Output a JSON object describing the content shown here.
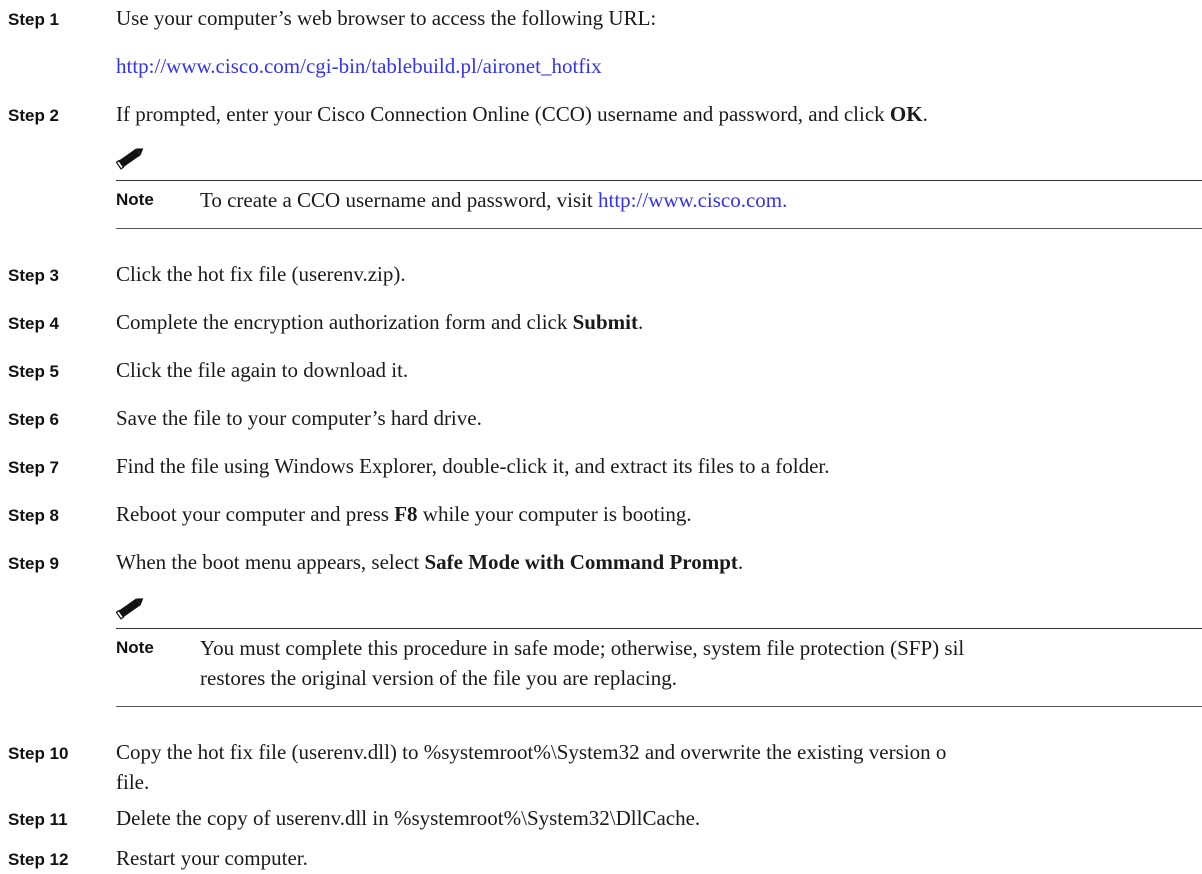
{
  "steps": [
    {
      "label": "Step 1",
      "text": "Use your computer’s web browser to access the following URL:",
      "link": "http://www.cisco.com/cgi-bin/tablebuild.pl/aironet_hotfix"
    },
    {
      "label": "Step 2",
      "text_before": "If prompted, enter your Cisco Connection Online (CCO) username and password, and click ",
      "bold": "OK",
      "text_after": "."
    },
    {
      "label": "Step 3",
      "text": "Click the hot fix file (userenv.zip)."
    },
    {
      "label": "Step 4",
      "text_before": "Complete the encryption authorization form and click ",
      "bold": "Submit",
      "text_after": "."
    },
    {
      "label": "Step 5",
      "text": "Click the file again to download it."
    },
    {
      "label": "Step 6",
      "text": "Save the file to your computer’s hard drive."
    },
    {
      "label": "Step 7",
      "text": "Find the file using Windows Explorer, double-click it, and extract its files to a folder."
    },
    {
      "label": "Step 8",
      "text_before": "Reboot your computer and press ",
      "bold": "F8",
      "text_after": " while your computer is booting."
    },
    {
      "label": "Step 9",
      "text_before": "When the boot menu appears, select ",
      "bold": "Safe Mode with Command Prompt",
      "text_after": "."
    },
    {
      "label": "Step 10",
      "line1": "Copy the hot fix file (userenv.dll) to %systemroot%\\System32 and overwrite the existing version o",
      "line2": "file."
    },
    {
      "label": "Step 11",
      "text": "Delete the copy of userenv.dll in %systemroot%\\System32\\DllCache."
    },
    {
      "label": "Step 12",
      "text": "Restart your computer."
    }
  ],
  "notes": [
    {
      "label": "Note",
      "text_before": "To create a CCO username and password, visit ",
      "link": "http://www.cisco.com."
    },
    {
      "label": "Note",
      "line1": "You must complete this procedure in safe mode; otherwise, system file protection (SFP) sil",
      "line2": "restores the original version of the file you are replacing."
    }
  ],
  "icons": {
    "note": "pencil-note-icon"
  }
}
